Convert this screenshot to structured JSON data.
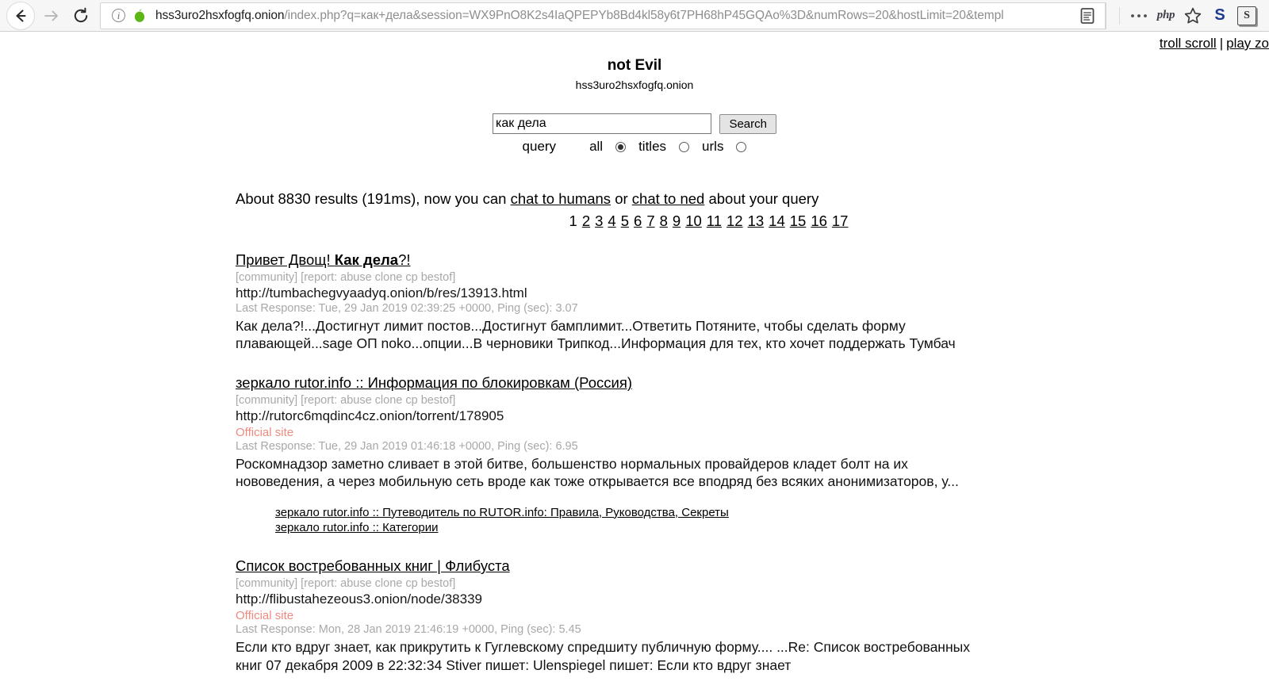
{
  "browser": {
    "back_label": "Back",
    "forward_label": "Forward",
    "reload_label": "Reload",
    "url_domain": "hss3uro2hsxfogfq.onion",
    "url_path": "/index.php?q=как+дела&session=WX9PnO8K2s4IaQPEPYb8Bd4kl58y6t7PH68hP45GQAo%3D&numRows=20&hostLimit=20&templ",
    "reader_icon_label": "Reader view",
    "menu_label": "…",
    "php_label": "php",
    "bookmark_label": "Bookmark",
    "s_blue_label": "S",
    "s_box_label": "S"
  },
  "corner": {
    "troll_scroll": "troll scroll",
    "separator": "|",
    "play_zone": "play zo"
  },
  "site": {
    "title": "not Evil",
    "subtitle": "hss3uro2hsxfogfq.onion"
  },
  "search": {
    "value": "как дела",
    "placeholder": "",
    "button_label": "Search",
    "query_label": "query",
    "options": [
      {
        "label": "all",
        "checked": true
      },
      {
        "label": "titles",
        "checked": false
      },
      {
        "label": "urls",
        "checked": false
      }
    ]
  },
  "summary": {
    "prefix": "About 8830 results (191ms), now you can ",
    "link1": "chat to humans",
    "mid": " or ",
    "link2": "chat to ned",
    "suffix": " about your query",
    "result_count": "8830",
    "time_ms": "191ms"
  },
  "pagination": {
    "current": "1",
    "pages": [
      "2",
      "3",
      "4",
      "5",
      "6",
      "7",
      "8",
      "9",
      "10",
      "11",
      "12",
      "13",
      "14",
      "15",
      "16",
      "17"
    ]
  },
  "results": [
    {
      "title_plain": "Привет Двощ! ",
      "title_bold": "Как дела",
      "title_tail": "?!",
      "tags": "[community] [report: abuse clone cp bestof]",
      "url": "http://tumbachegvyaadyq.onion/b/res/13913.html",
      "official": "",
      "meta": "Last Response: Tue, 29 Jan 2019 02:39:25 +0000, Ping (sec): 3.07",
      "snippet": "Как дела?!...Достигнут лимит постов...Достигнут бамплимит...Ответить Потяните, чтобы сделать форму плавающей...sage ОП noko...опции...В черновики Трипкод...Информация для тех, кто хочет поддержать Тумбач",
      "sublinks": []
    },
    {
      "title_plain": "зеркало rutor.info :: Информация по блокировкам (Россия)",
      "title_bold": "",
      "title_tail": "",
      "tags": "[community] [report: abuse clone cp bestof]",
      "url": "http://rutorc6mqdinc4cz.onion/torrent/178905",
      "official": "Official site",
      "meta": "Last Response: Tue, 29 Jan 2019 01:46:18 +0000, Ping (sec): 6.95",
      "snippet": "Роскомнадзор заметно сливает в этой битве, большенство нормальных провайдеров кладет болт на их нововедения, а через мобильную сеть вроде как тоже открывается все вподряд без всяких анонимизаторов, у...",
      "sublinks": [
        "зеркало rutor.info :: Путеводитель по RUTOR.info: Правила, Руководства, Секреты",
        "зеркало rutor.info :: Категории"
      ]
    },
    {
      "title_plain": "Список востребованных книг | Флибуста",
      "title_bold": "",
      "title_tail": "",
      "tags": "[community] [report: abuse clone cp bestof]",
      "url": "http://flibustahezeous3.onion/node/38339",
      "official": "Official site",
      "meta": "Last Response: Mon, 28 Jan 2019 21:46:19 +0000, Ping (sec): 5.45",
      "snippet": "Если кто вдруг знает, как прикрутить к Гуглевскому спредшиту публичную форму.... ...Re: Список востребованных книг  07 декабря 2009  в 22:32:34 Stiver пишет:   Ulenspiegel пишет:   Если кто вдруг знает",
      "sublinks": []
    }
  ],
  "colors": {
    "official_site": "#ef8a80",
    "meta_gray": "#a8a8a8",
    "onion_green": "#5cb615",
    "link_black": "#000000"
  }
}
